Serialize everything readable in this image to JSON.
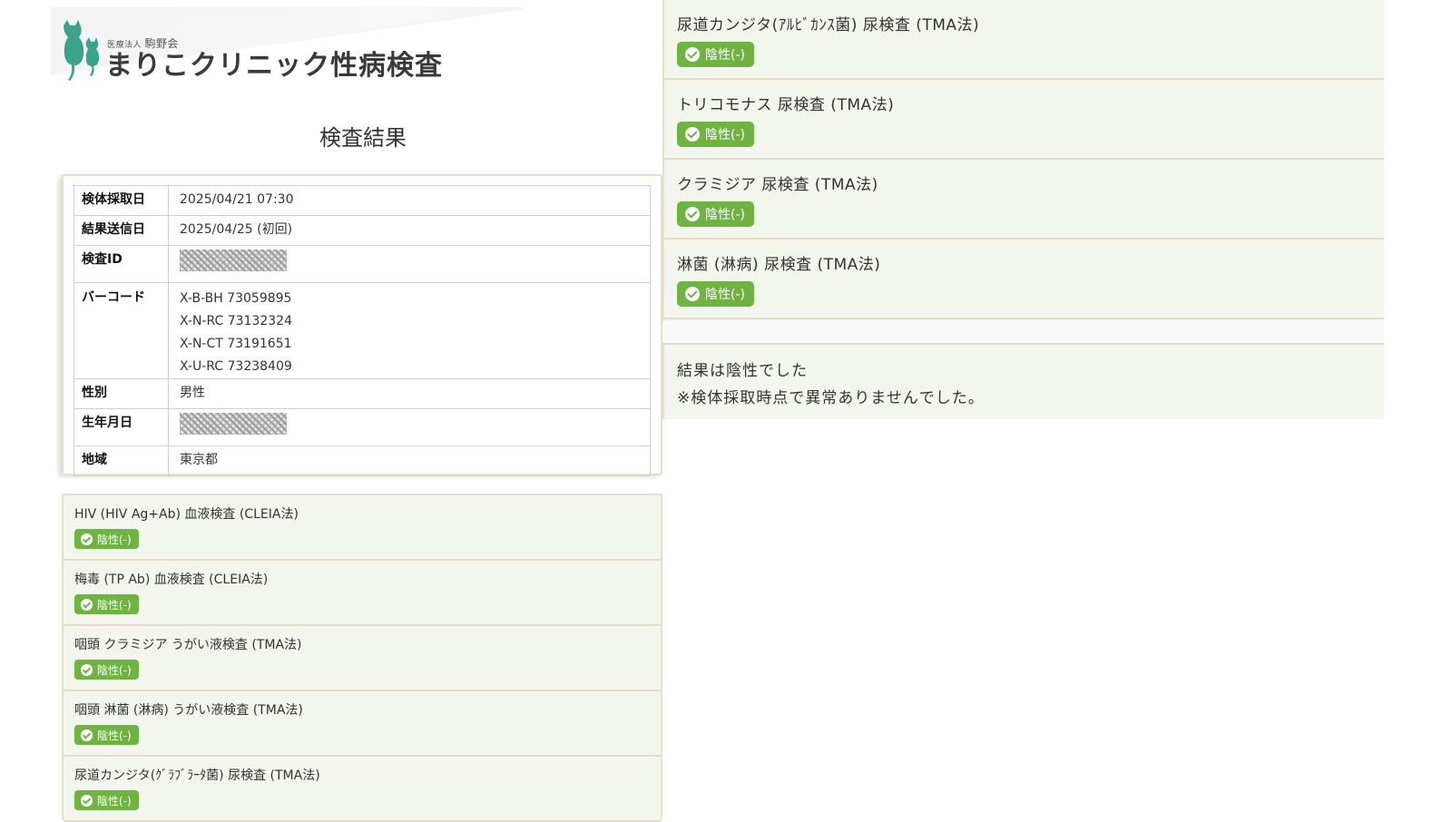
{
  "header": {
    "org_prefix": "医療法人",
    "org_name": "駒野会",
    "clinic_name": "まりこクリニック性病検査"
  },
  "page_title": "検査結果",
  "info": {
    "collection_date_label": "検体採取日",
    "collection_date": "2025/04/21 07:30",
    "sent_date_label": "結果送信日",
    "sent_date": "2025/04/25 (初回)",
    "test_id_label": "検査ID",
    "barcode_label": "バーコード",
    "barcodes": [
      "X-B-BH 73059895",
      "X-N-RC 73132324",
      "X-N-CT 73191651",
      "X-U-RC 73238409"
    ],
    "sex_label": "性別",
    "sex": "男性",
    "birth_label": "生年月日",
    "region_label": "地域",
    "region": "東京都"
  },
  "left_tests": [
    {
      "name": "HIV (HIV Ag+Ab) 血液検査 (CLEIA法)",
      "result": "陰性(-)"
    },
    {
      "name": "梅毒 (TP Ab) 血液検査 (CLEIA法)",
      "result": "陰性(-)"
    },
    {
      "name": "咽頭 クラミジア うがい液検査 (TMA法)",
      "result": "陰性(-)"
    },
    {
      "name": "咽頭 淋菌 (淋病) うがい液検査 (TMA法)",
      "result": "陰性(-)"
    },
    {
      "name": "尿道カンジタ(ｸﾞﾗﾌﾞﾗｰﾀ菌) 尿検査 (TMA法)",
      "result": "陰性(-)"
    }
  ],
  "right_tests": [
    {
      "name": "尿道カンジタ(ｱﾙﾋﾞｶﾝｽ菌) 尿検査 (TMA法)",
      "result": "陰性(-)"
    },
    {
      "name": "トリコモナス 尿検査 (TMA法)",
      "result": "陰性(-)"
    },
    {
      "name": "クラミジア 尿検査 (TMA法)",
      "result": "陰性(-)"
    },
    {
      "name": "淋菌 (淋病) 尿検査 (TMA法)",
      "result": "陰性(-)"
    }
  ],
  "summary": {
    "line1": "結果は陰性でした",
    "line2": "※検体採取時点で異常ありませんでした。"
  },
  "colors": {
    "badge_green": "#6fb443",
    "card_bg": "#f2f6ec",
    "card_border": "#e7dfc9",
    "logo_teal": "#3aa38a"
  }
}
